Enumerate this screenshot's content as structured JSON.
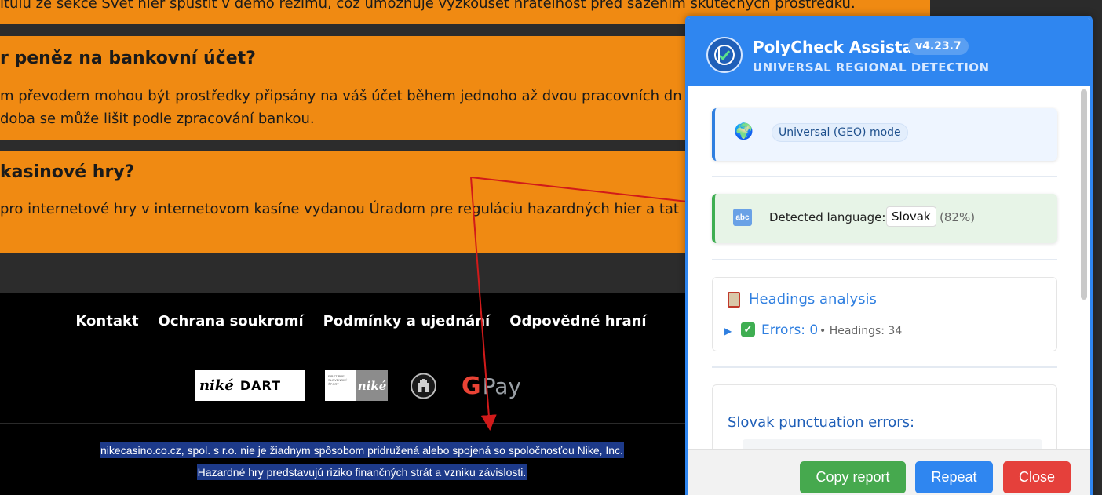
{
  "page": {
    "faq_top_answer": "itulů ze sekce Svět hier spustit v demo režimu, což umožňuje vyzkoušet hratelnost před sázením skutečných prostředků.",
    "faq": [
      {
        "question": "r peněz na bankovní účet?",
        "answer_lines": [
          "m převodem mohou být prostředky připsány na váš účet během jednoho až dvou pracovních dn",
          "doba se může lišit podle zpracování bankou."
        ]
      },
      {
        "question": "kasinové hry?",
        "answer_lines": [
          "pro internetové hry v internetovom kasíne vydanou Úradom pre reguláciu hazardných hier a tat"
        ]
      }
    ],
    "footer_links": [
      "Kontakt",
      "Ochrana soukromí",
      "Podmínky a ujednání",
      "Odpovědné hraní"
    ],
    "logos": {
      "dart_nike": "niké",
      "dart_text": "DART",
      "nike_small": "niké",
      "nike_small_caption": "FIRST PRE SLOVENSKÝ ŠPORT",
      "gpay_g": "G",
      "gpay_text": "Pay"
    },
    "disclaimer_lines": [
      "nikecasino.co.cz, spol. s r.o. nie je žiadnym spôsobom pridružená alebo spojená so spoločnosťou Nike, Inc.",
      "Hazardné hry predstavujú riziko finančných strát a vzniku závislosti."
    ]
  },
  "extension": {
    "title": "PolyCheck Assistant",
    "version": "v4.23.7",
    "subtitle": "UNIVERSAL REGIONAL DETECTION",
    "mode_label": "Universal (GEO) mode",
    "language_icon_text": "abc",
    "detected_language_label": "Detected language:",
    "detected_language": "Slovak",
    "confidence": "(82%)",
    "headings_title": "Headings analysis",
    "errors_label": "Errors: 0",
    "headings_count": "• Headings: 34",
    "punctuation_title": "Slovak punctuation errors:",
    "buttons": {
      "copy": "Copy report",
      "repeat": "Repeat",
      "close": "Close"
    }
  },
  "colors": {
    "faq_orange": "#f08a12",
    "panel_blue": "#2f86f0",
    "copy_green": "#46a94e",
    "close_red": "#e5403b",
    "annotation_red": "#d11a1a",
    "highlight_blue": "#1d3a8a"
  },
  "icons": [
    "globe-icon",
    "abc-icon",
    "clipboard-icon",
    "expand-triangle-icon",
    "checkmark-icon",
    "polycheck-logo-icon"
  ]
}
